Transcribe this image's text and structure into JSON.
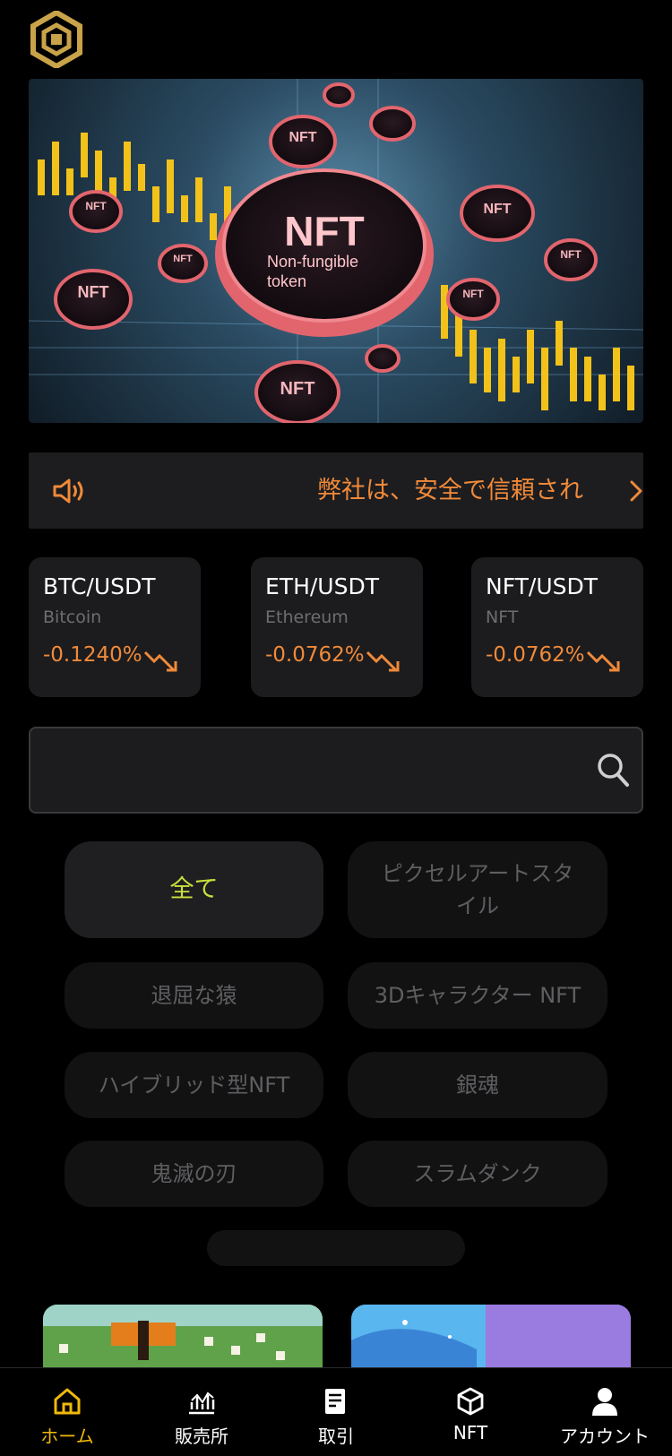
{
  "notice": {
    "text": "弊社は、安全で信頼され"
  },
  "banner": {
    "main_title": "NFT",
    "main_subtitle_1": "Non-fungible",
    "main_subtitle_2": "token",
    "coin_label": "NFT"
  },
  "tickers": [
    {
      "pair": "BTC/USDT",
      "name": "Bitcoin",
      "change": "-0.1240%"
    },
    {
      "pair": "ETH/USDT",
      "name": "Ethereum",
      "change": "-0.0762%"
    },
    {
      "pair": "NFT/USDT",
      "name": "NFT",
      "change": "-0.0762%"
    }
  ],
  "search": {
    "value": "",
    "placeholder": ""
  },
  "categories": [
    {
      "label": "全て",
      "active": true
    },
    {
      "label": "ピクセルアートスタイル",
      "active": false
    },
    {
      "label": "退屈な猿",
      "active": false
    },
    {
      "label": "3Dキャラクター NFT",
      "active": false
    },
    {
      "label": "ハイブリッド型NFT",
      "active": false
    },
    {
      "label": "銀魂",
      "active": false
    },
    {
      "label": "鬼滅の刃",
      "active": false
    },
    {
      "label": "スラムダンク",
      "active": false
    }
  ],
  "tabbar": [
    {
      "label": "ホーム",
      "icon": "home-icon",
      "active": true
    },
    {
      "label": "販売所",
      "icon": "chart-icon",
      "active": false
    },
    {
      "label": "取引",
      "icon": "document-icon",
      "active": false
    },
    {
      "label": "NFT",
      "icon": "cube-icon",
      "active": false
    },
    {
      "label": "アカウント",
      "icon": "user-icon",
      "active": false
    }
  ],
  "colors": {
    "accent": "#f08a3a",
    "active_category": "#c9e03b",
    "active_tab": "#f0b90b",
    "logo": "#c9a34a"
  }
}
